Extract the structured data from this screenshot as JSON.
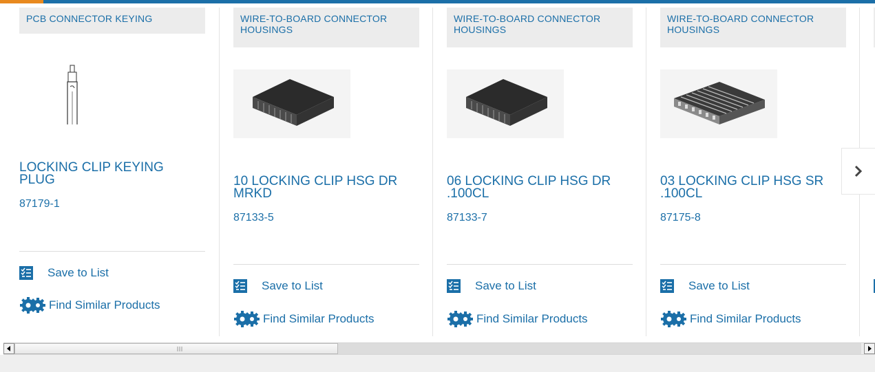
{
  "cards": [
    {
      "category": "PCB CONNECTOR KEYING",
      "title": "LOCKING CLIP KEYING PLUG",
      "part_number": "87179-1",
      "save_label": "Save to List",
      "similar_label": "Find Similar Products"
    },
    {
      "category": "WIRE-TO-BOARD CONNECTOR HOUSINGS",
      "title": "10 LOCKING CLIP HSG DR MRKD",
      "part_number": "87133-5",
      "save_label": "Save to List",
      "similar_label": "Find Similar Products"
    },
    {
      "category": "WIRE-TO-BOARD CONNECTOR HOUSINGS",
      "title": "06 LOCKING CLIP HSG DR .100CL",
      "part_number": "87133-7",
      "save_label": "Save to List",
      "similar_label": "Find Similar Products"
    },
    {
      "category": "WIRE-TO-BOARD CONNECTOR HOUSINGS",
      "title": "03 LOCKING CLIP HSG SR .100CL",
      "part_number": "87175-8",
      "save_label": "Save to List",
      "similar_label": "Find Similar Products"
    }
  ],
  "icons": {
    "save": "list-check-icon",
    "similar": "gears-icon",
    "next": "chevron-right-icon",
    "scroll_left": "triangle-left-icon",
    "scroll_right": "triangle-right-icon"
  },
  "colors": {
    "brand_blue": "#1b6fa8",
    "accent_orange": "#e8891e",
    "tag_bg": "#ececec"
  }
}
